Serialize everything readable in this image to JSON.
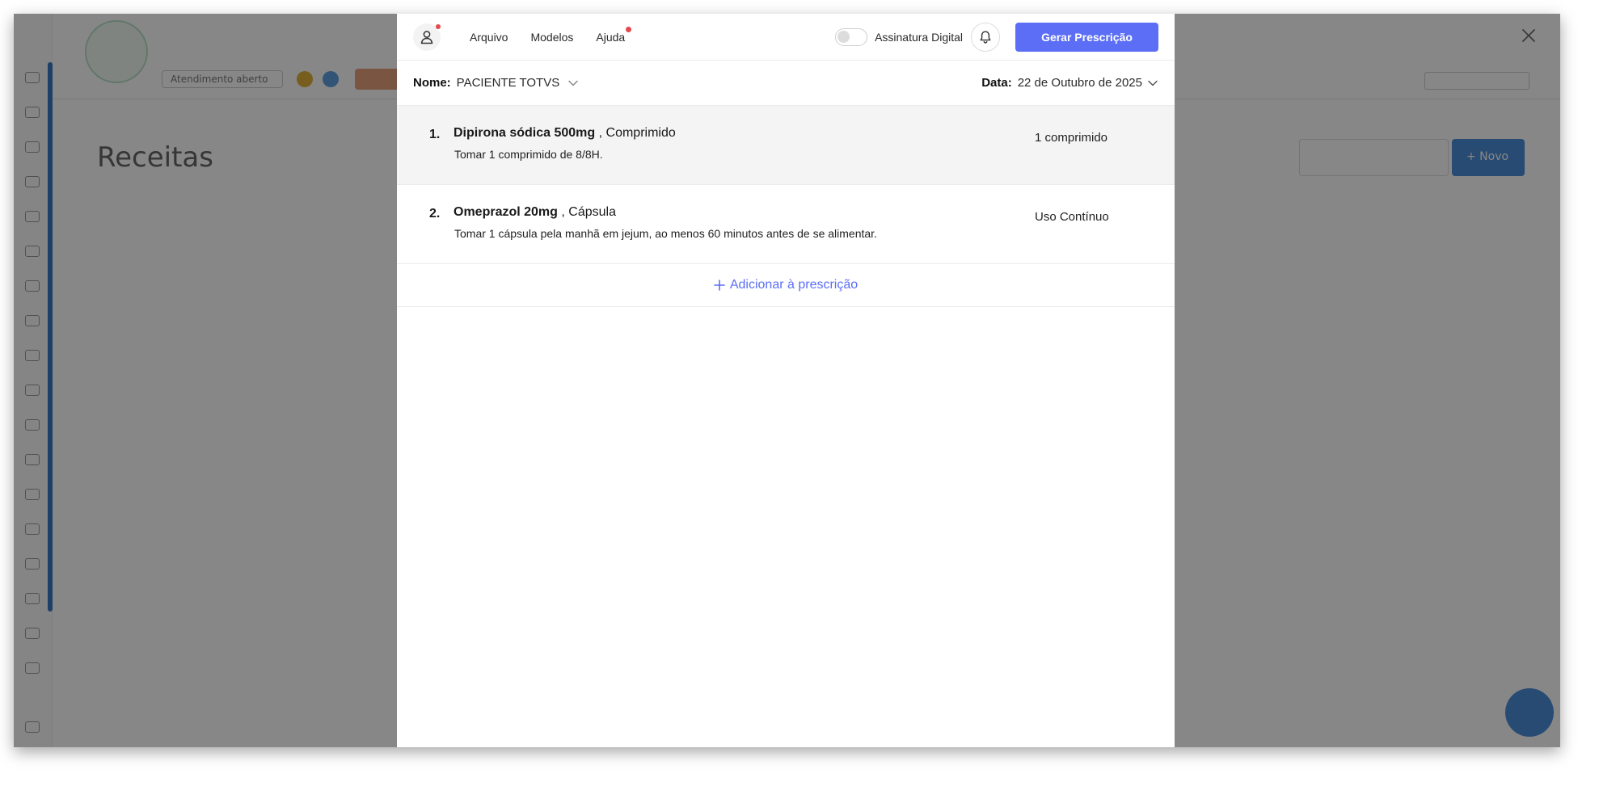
{
  "modal": {
    "menu": [
      {
        "label": "Arquivo",
        "badge": false
      },
      {
        "label": "Modelos",
        "badge": false
      },
      {
        "label": "Ajuda",
        "badge": true
      }
    ],
    "digital_signature": {
      "label": "Assinatura Digital",
      "enabled": false
    },
    "generate_button": "Gerar Prescrição",
    "patient": {
      "label": "Nome:",
      "value": "PACIENTE TOTVS"
    },
    "date": {
      "label": "Data:",
      "value": "22 de Outubro de 2025"
    },
    "prescriptions": [
      {
        "number": "1.",
        "drug": "Dipirona sódica 500mg",
        "form": ", Comprimido",
        "instructions": "Tomar 1 comprimido de 8/8H.",
        "quantity": "1 comprimido"
      },
      {
        "number": "2.",
        "drug": "Omeprazol 20mg",
        "form": ", Cápsula",
        "instructions": "Tomar 1 cápsula pela manhã em jejum, ao menos 60 minutos antes de se alimentar.",
        "quantity": "Uso Contínuo"
      }
    ],
    "add_label": "Adicionar à prescrição"
  },
  "background": {
    "page_title": "Receitas",
    "attendance_chip": "Atendimento aberto",
    "new_button": "+ Novo"
  },
  "colors": {
    "accent": "#5b6ef5",
    "badge": "#e5484d",
    "overlay": "rgba(0,0,0,0.47)"
  },
  "icons": {
    "user": "user-icon",
    "bell": "bell-icon",
    "close": "close-icon",
    "chevron": "chevron-down-icon",
    "plus": "plus-icon"
  }
}
